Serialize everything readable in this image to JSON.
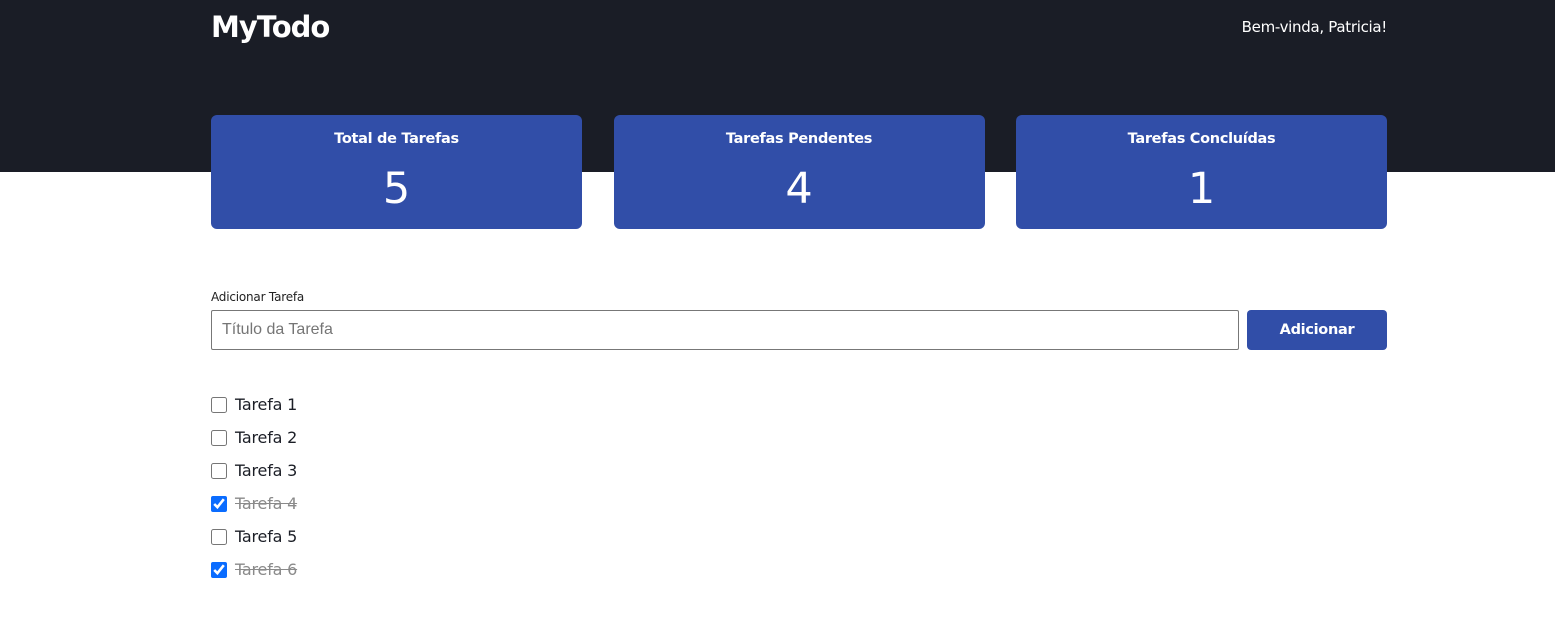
{
  "header": {
    "brand": "MyTodo",
    "greeting": "Bem-vinda, Patricia!"
  },
  "stats": [
    {
      "title": "Total de Tarefas",
      "value": "5"
    },
    {
      "title": "Tarefas Pendentes",
      "value": "4"
    },
    {
      "title": "Tarefas Concluídas",
      "value": "1"
    }
  ],
  "add_task": {
    "label": "Adicionar Tarefa",
    "placeholder": "Título da Tarefa",
    "value": "",
    "button_label": "Adicionar"
  },
  "tasks": [
    {
      "title": "Tarefa 1",
      "done": false
    },
    {
      "title": "Tarefa 2",
      "done": false
    },
    {
      "title": "Tarefa 3",
      "done": false
    },
    {
      "title": "Tarefa 4",
      "done": true
    },
    {
      "title": "Tarefa 5",
      "done": false
    },
    {
      "title": "Tarefa 6",
      "done": true
    }
  ],
  "colors": {
    "header_bg": "#1a1d26",
    "accent": "#314ea8",
    "checkbox": "#0a6cff",
    "done_text": "#8a8a8a"
  }
}
